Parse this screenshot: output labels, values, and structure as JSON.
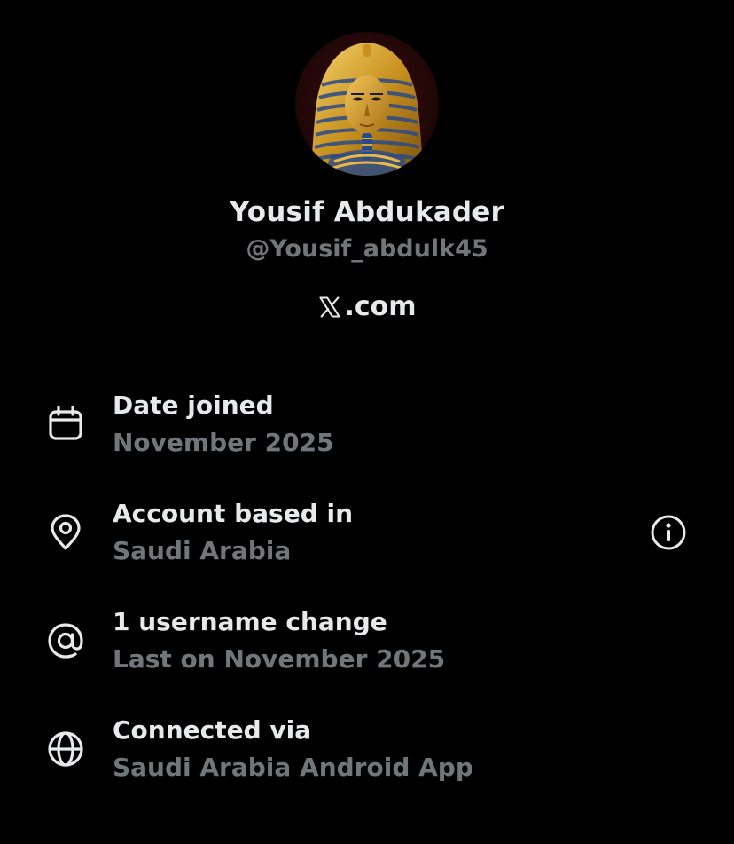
{
  "profile": {
    "display_name": "Yousif Abdukader",
    "handle": "@Yousif_abdulk45",
    "site_text": ".com",
    "site_logo_icon": "x-logo-icon",
    "avatar_icon": "pharaoh-mask-avatar"
  },
  "about": [
    {
      "icon": "calendar-icon",
      "label": "Date joined",
      "value": "November 2025"
    },
    {
      "icon": "location-pin-icon",
      "label": "Account based in",
      "value": "Saudi Arabia",
      "trailing_icon": "info-icon"
    },
    {
      "icon": "at-sign-icon",
      "label": "1 username change",
      "value": "Last on November 2025"
    },
    {
      "icon": "globe-icon",
      "label": "Connected via",
      "value": "Saudi Arabia Android App"
    }
  ],
  "colors": {
    "background": "#000000",
    "primary_text": "#e7e9ea",
    "secondary_text": "#71767b"
  }
}
